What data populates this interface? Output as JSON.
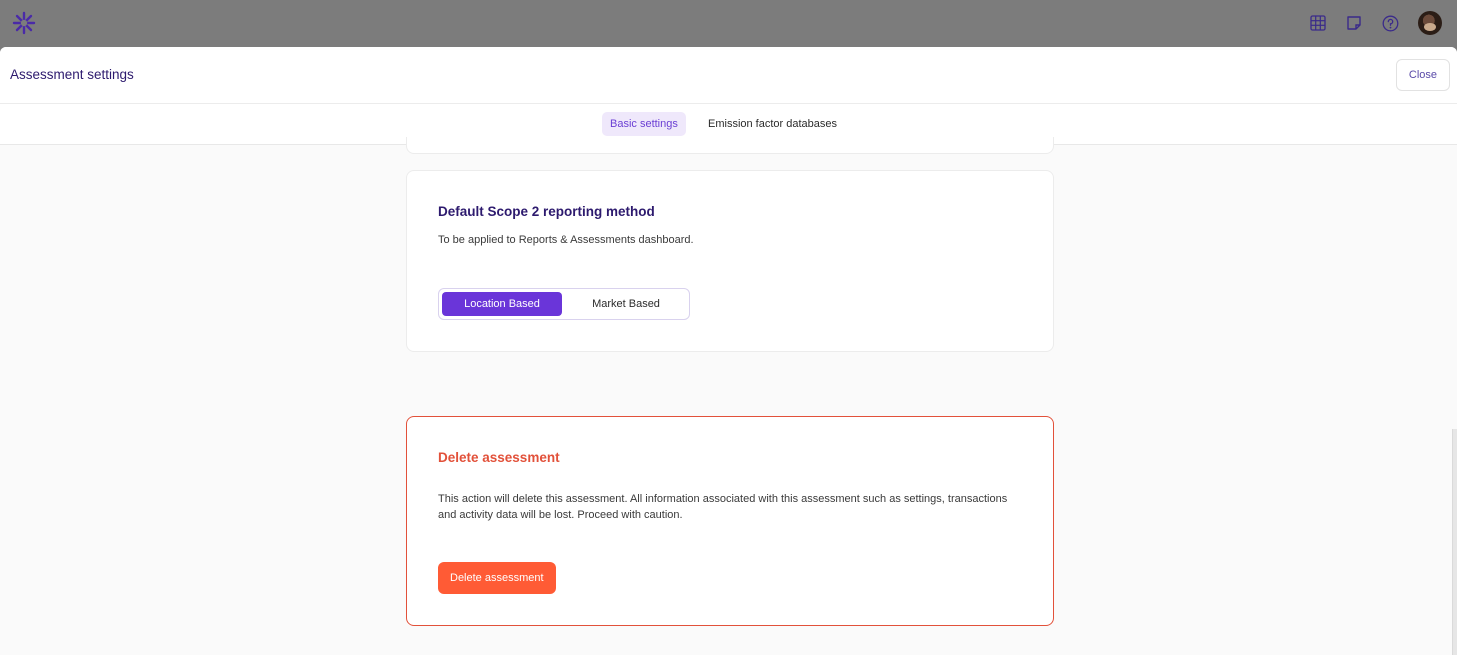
{
  "header": {
    "title": "Assessment settings",
    "close_label": "Close"
  },
  "tabs": [
    {
      "label": "Basic settings",
      "active": true
    },
    {
      "label": "Emission factor databases",
      "active": false
    }
  ],
  "scope2": {
    "title": "Default Scope 2 reporting method",
    "description": "To be applied to Reports & Assessments dashboard.",
    "options": [
      {
        "label": "Location Based",
        "selected": true
      },
      {
        "label": "Market Based",
        "selected": false
      }
    ]
  },
  "delete_section": {
    "title": "Delete assessment",
    "description": "This action will delete this assessment. All information associated with this assessment such as settings, transactions and activity data will be lost. Proceed with caution.",
    "button_label": "Delete assessment"
  },
  "colors": {
    "brand_purple": "#6a35d9",
    "danger": "#e2513a",
    "delete_button": "#ff5b35"
  },
  "icons": [
    "asterisk-logo-icon",
    "grid-icon",
    "sticky-note-icon",
    "help-icon",
    "user-avatar"
  ]
}
